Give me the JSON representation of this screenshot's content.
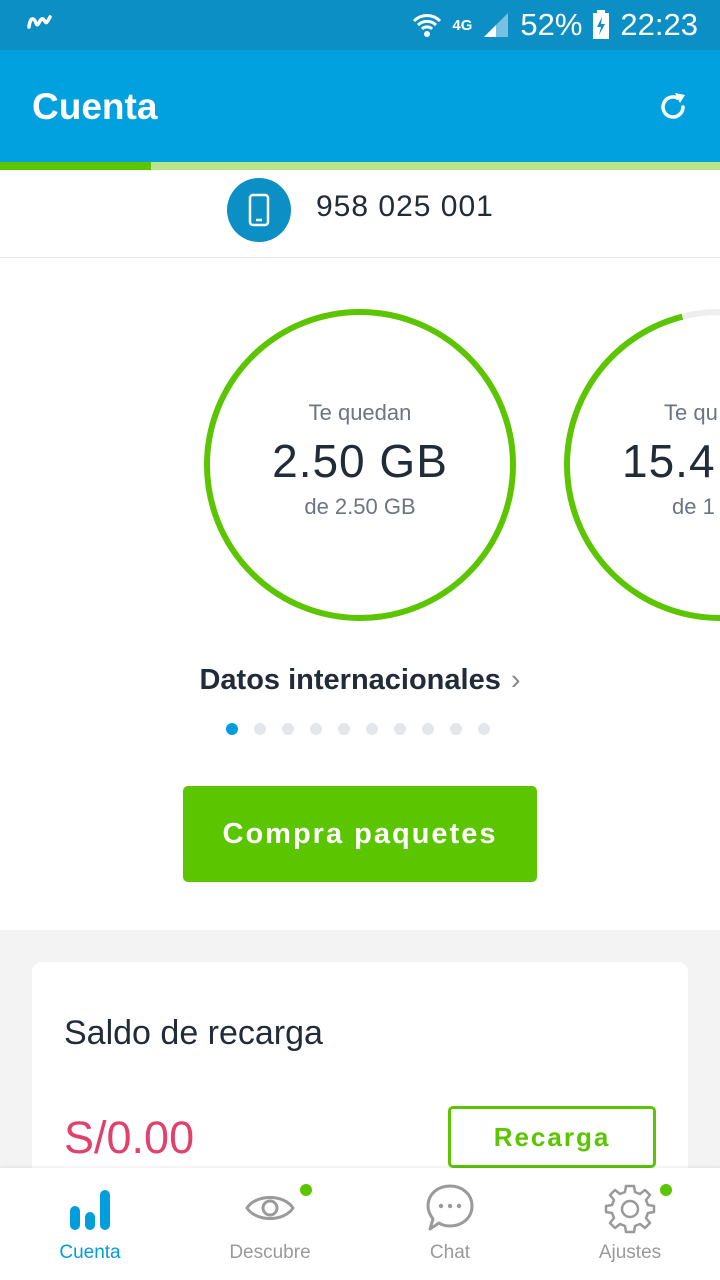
{
  "status_bar": {
    "network": "4G",
    "battery": "52%",
    "time": "22:23"
  },
  "app_bar": {
    "title": "Cuenta",
    "refresh_icon": "refresh-icon"
  },
  "progress": {
    "fill_fraction": 0.21
  },
  "line": {
    "number": "958 025 001",
    "icon": "phone-icon"
  },
  "balances": [
    {
      "caption": "Te quedan",
      "value": "2.50 GB",
      "total": "de 2.50 GB",
      "remaining_fraction": 1.0
    },
    {
      "caption": "Te qu",
      "value": "15.4",
      "total": "de 1",
      "remaining_fraction": 0.96
    }
  ],
  "plan": {
    "name": "Datos internacionales",
    "chevron": "›"
  },
  "pager": {
    "count": 10,
    "active": 0
  },
  "buy_button": {
    "label": "Compra paquetes"
  },
  "recharge": {
    "label": "Saldo de recarga",
    "amount": "S/0.00",
    "button": "Recarga"
  },
  "nav": [
    {
      "label": "Cuenta",
      "icon": "bar-chart-icon",
      "active": true,
      "badge": false
    },
    {
      "label": "Descubre",
      "icon": "eye-icon",
      "active": false,
      "badge": true
    },
    {
      "label": "Chat",
      "icon": "chat-bubble-icon",
      "active": false,
      "badge": false
    },
    {
      "label": "Ajustes",
      "icon": "gear-icon",
      "active": false,
      "badge": true
    }
  ],
  "colors": {
    "primary": "#01a1df",
    "status": "#0b8fc4",
    "green": "#5bc500",
    "amount": "#e0426d"
  }
}
